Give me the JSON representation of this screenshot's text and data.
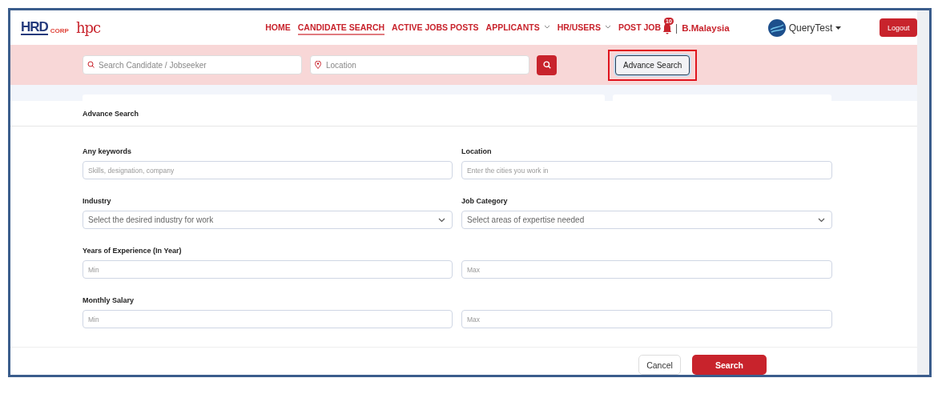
{
  "logo": {
    "brand": "HRD",
    "suffix": "CORP",
    "second": "hpc"
  },
  "nav": [
    {
      "label": "HOME",
      "selected": false,
      "has_menu": false
    },
    {
      "label": "CANDIDATE SEARCH",
      "selected": true,
      "has_menu": false
    },
    {
      "label": "ACTIVE JOBS POSTS",
      "selected": false,
      "has_menu": false
    },
    {
      "label": "APPLICANTS",
      "selected": false,
      "has_menu": true
    },
    {
      "label": "HR/USERS",
      "selected": false,
      "has_menu": true
    },
    {
      "label": "POST JOB",
      "selected": false,
      "has_menu": false
    }
  ],
  "notifications": {
    "count": "10"
  },
  "language_separator": "|",
  "language": "B.Malaysia",
  "user": {
    "name": "QueryTest"
  },
  "logout": "Logout",
  "search_bar": {
    "keyword_placeholder": "Search Candidate / Jobseeker",
    "location_placeholder": "Location",
    "advance_button": "Advance Search",
    "advance_highlighted": true
  },
  "modal": {
    "title": "Advance Search",
    "fields": [
      {
        "label": "Any keywords",
        "kind": "text",
        "placeholder": "Skills, designation, company"
      },
      {
        "label": "Location",
        "kind": "text",
        "placeholder": "Enter the cities you work in"
      },
      {
        "label": "Industry",
        "kind": "select",
        "placeholder": "Select the desired industry for work"
      },
      {
        "label": "Job Category",
        "kind": "select",
        "placeholder": "Select areas of expertise needed"
      },
      {
        "label": "Years of Experience (In Year)",
        "kind": "range",
        "min_placeholder": "Min",
        "max_placeholder": "Max"
      },
      {
        "label": "Monthly Salary",
        "kind": "range",
        "min_placeholder": "Min",
        "max_placeholder": "Max"
      }
    ],
    "buttons": [
      {
        "label": "Cancel",
        "kind": "secondary"
      },
      {
        "label": "Search",
        "kind": "primary"
      }
    ]
  }
}
